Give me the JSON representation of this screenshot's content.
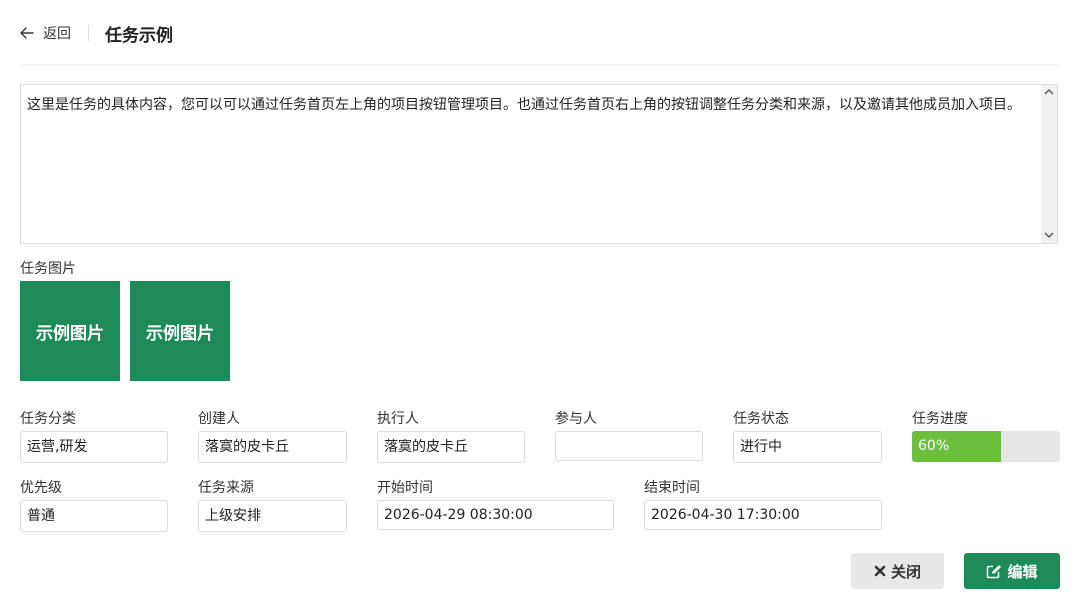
{
  "header": {
    "back_label": "返回",
    "title": "任务示例"
  },
  "content": {
    "text": "这里是任务的具体内容，您可以可以通过任务首页左上角的项目按钮管理项目。也通过任务首页右上角的按钮调整任务分类和来源，以及邀请其他成员加入项目。"
  },
  "images": {
    "label": "任务图片",
    "items": [
      "示例图片",
      "示例图片"
    ]
  },
  "fields": {
    "category": {
      "label": "任务分类",
      "value": "运营,研发"
    },
    "creator": {
      "label": "创建人",
      "value": "落寞的皮卡丘"
    },
    "executor": {
      "label": "执行人",
      "value": "落寞的皮卡丘"
    },
    "participants": {
      "label": "参与人",
      "value": ""
    },
    "status": {
      "label": "任务状态",
      "value": "进行中"
    },
    "progress": {
      "label": "任务进度",
      "value": 60,
      "text": "60%"
    },
    "priority": {
      "label": "优先级",
      "value": "普通"
    },
    "source": {
      "label": "任务来源",
      "value": "上级安排"
    },
    "start_time": {
      "label": "开始时间",
      "value": "2026-04-29 08:30:00"
    },
    "end_time": {
      "label": "结束时间",
      "value": "2026-04-30 17:30:00"
    }
  },
  "actions": {
    "close_label": "关闭",
    "edit_label": "编辑"
  },
  "colors": {
    "primary": "#1e8a5a",
    "progress": "#6abf3c",
    "close_bg": "#e8e8e8"
  },
  "icons": {
    "back": "arrow-left-icon",
    "close": "x-icon",
    "edit": "edit-icon"
  }
}
